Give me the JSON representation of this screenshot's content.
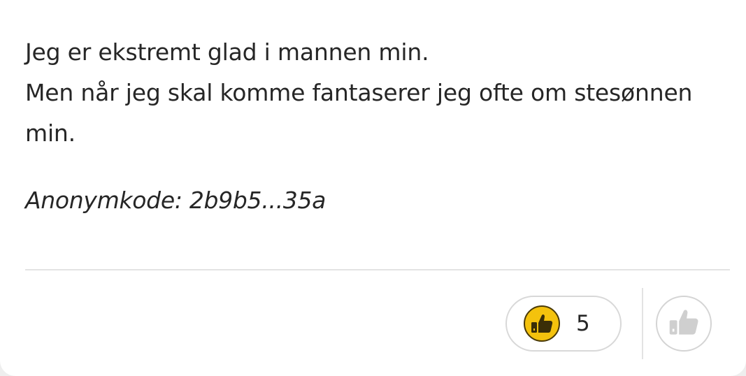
{
  "post": {
    "lines": [
      "Jeg er ekstremt glad i mannen min.",
      "Men når jeg skal komme fantaserer jeg ofte om stesønnen min."
    ],
    "anon_code": "Anonymkode: 2b9b5...35a"
  },
  "reactions": {
    "like_count": "5",
    "like_icon": "thumbs-up-icon",
    "react_icon": "thumbs-up-outline-icon"
  },
  "colors": {
    "like_fill": "#f4c20d",
    "text": "#262626",
    "divider": "#e3e3e3"
  }
}
